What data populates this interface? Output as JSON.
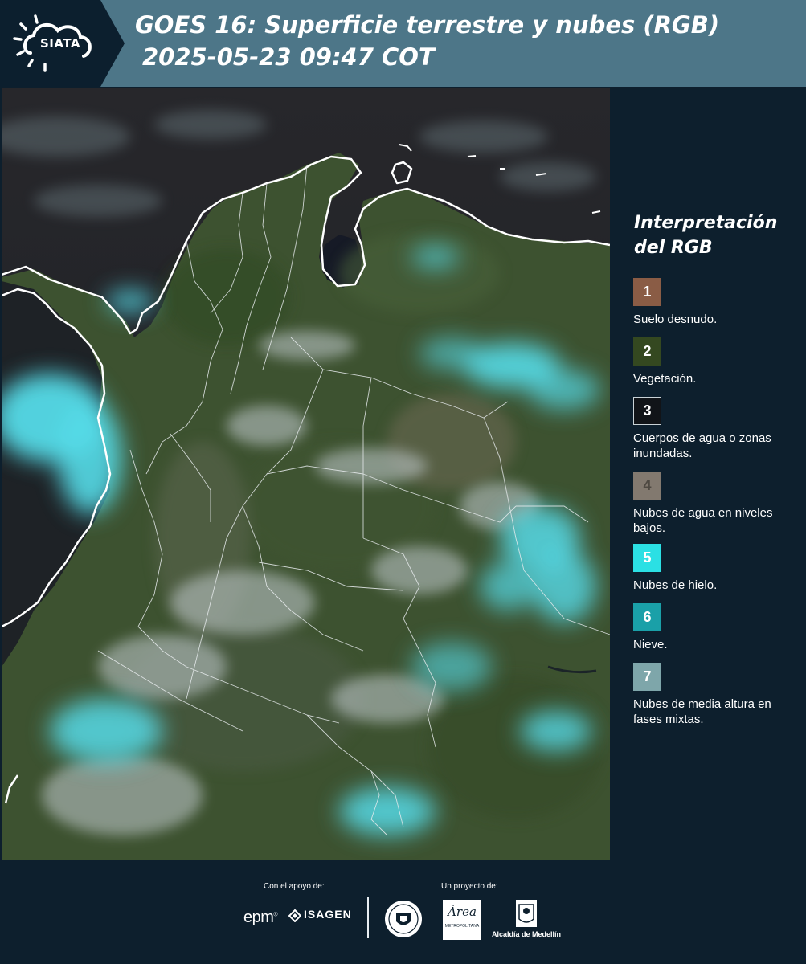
{
  "header": {
    "logo_text": "SIATA",
    "title_line1": "GOES 16: Superficie terrestre y nubes (RGB)",
    "title_line2": "2025-05-23 09:47 COT"
  },
  "legend": {
    "title": "Interpretación del RGB",
    "items": [
      {
        "num": "1",
        "label": "Suelo desnudo.",
        "color": "#8a5c45"
      },
      {
        "num": "2",
        "label": "Vegetación.",
        "color": "#344820"
      },
      {
        "num": "3",
        "label": "Cuerpos de agua o zonas inundadas.",
        "color": "#111418"
      },
      {
        "num": "4",
        "label": "Nubes de agua en niveles bajos.",
        "color": "#82796f"
      },
      {
        "num": "5",
        "label": "Nubes de hielo.",
        "color": "#2be0e4"
      },
      {
        "num": "6",
        "label": "Nieve.",
        "color": "#1aa0a8"
      },
      {
        "num": "7",
        "label": "Nubes de media altura en fases mixtas.",
        "color": "#7ea6aa"
      }
    ]
  },
  "footer": {
    "support_label": "Con el apoyo de:",
    "project_label": "Un proyecto de:",
    "epm": "epm",
    "isagen": "ISAGEN",
    "area_metro": "Área",
    "area_metro_sub": "METROPOLITANA",
    "alcaldia": "Alcaldía de Medellín"
  },
  "colors": {
    "header_bg": "#4d7688",
    "page_bg": "#0d1f2d",
    "ocean": "#1a1e24",
    "vegetation": "#3a5328",
    "ice_clouds": "#5fd9e6"
  }
}
